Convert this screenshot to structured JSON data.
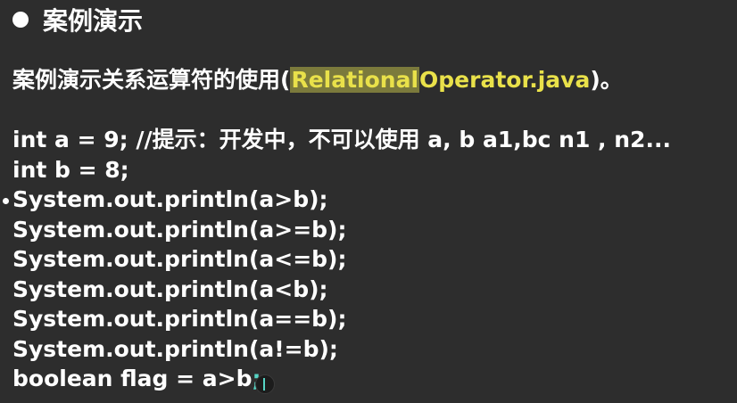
{
  "heading": {
    "text": "案例演示"
  },
  "intro": {
    "prefix": "案例演示关系运算符的使用(",
    "highlighted": "Relational",
    "accent": "Operator.java",
    "suffix": ")。"
  },
  "code": {
    "lines": [
      "int a = 9;  //提示：开发中，不可以使用  a, b a1,bc n1 , n2...",
      "int b = 8;",
      "System.out.println(a>b);",
      "System.out.println(a>=b);",
      "System.out.println(a<=b);",
      "System.out.println(a<b);",
      "System.out.println(a==b);",
      "System.out.println(a!=b);"
    ],
    "last_line_main": "boolean flag = a>b",
    "last_line_end": ";"
  },
  "colors": {
    "background": "#2d2d2d",
    "text": "#ffffff",
    "accent_yellow": "#e9e14a",
    "highlight_bg": "#7b7a3c",
    "cursor_teal": "#56d4c4"
  }
}
